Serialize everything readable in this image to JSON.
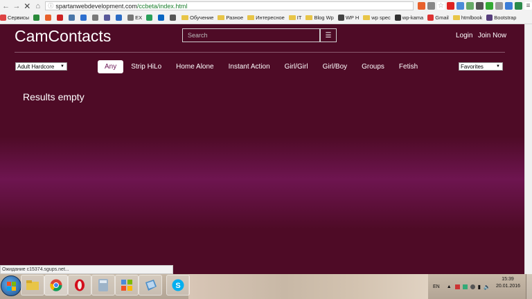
{
  "browser": {
    "url_host": "spartanwebdevelopment.com",
    "url_path": "/ccbeta/index.html",
    "bookmarks": [
      {
        "label": "Сервисы",
        "icon": "apps-grid-icon"
      },
      {
        "label": "",
        "icon": "green-shield-icon"
      },
      {
        "label": "",
        "icon": "orange-square-icon"
      },
      {
        "label": "",
        "icon": "red-square-icon"
      },
      {
        "label": "",
        "icon": "vk-icon"
      },
      {
        "label": "",
        "icon": "blue-square-icon"
      },
      {
        "label": "",
        "icon": "gray-square-icon"
      },
      {
        "label": "",
        "icon": "letter-square-icon"
      },
      {
        "label": "",
        "icon": "up-arrow-icon"
      },
      {
        "label": "EX",
        "icon": "ex-icon"
      },
      {
        "label": "",
        "icon": "green-circle-icon"
      },
      {
        "label": "",
        "icon": "linkedin-icon"
      },
      {
        "label": "",
        "icon": "play-icon"
      },
      {
        "label": "Обучение",
        "icon": "folder-icon"
      },
      {
        "label": "Разное",
        "icon": "folder-icon"
      },
      {
        "label": "Интересное",
        "icon": "folder-icon"
      },
      {
        "label": "IT",
        "icon": "folder-icon"
      },
      {
        "label": "Blog Wp",
        "icon": "folder-icon"
      },
      {
        "label": "WP H",
        "icon": "wordpress-icon"
      },
      {
        "label": "wp spec",
        "icon": "folder-icon"
      },
      {
        "label": "wp-kama",
        "icon": "kama-icon"
      },
      {
        "label": "Gmail",
        "icon": "gmail-icon"
      },
      {
        "label": "htmlbook",
        "icon": "folder-icon"
      },
      {
        "label": "Bootstrap",
        "icon": "bootstrap-icon"
      }
    ],
    "status_text": "Ожидание c15374.sgups.net..."
  },
  "site": {
    "brand": "CamContacts",
    "search_placeholder": "Search",
    "login": "Login",
    "join": "Join Now",
    "category_select": "Adult Hardcore",
    "favorites_select": "Favorites",
    "tabs": [
      "Any",
      "Strip HiLo",
      "Home Alone",
      "Instant Action",
      "Girl/Girl",
      "Girl/Boy",
      "Groups",
      "Fetish"
    ],
    "results_text": "Results empty"
  },
  "taskbar": {
    "lang": "EN",
    "time": "15:39",
    "date": "20.01.2016",
    "apps": [
      "file-explorer-icon",
      "chrome-icon",
      "opera-icon",
      "calculator-icon",
      "control-panel-icon",
      "virtualbox-icon",
      "skype-icon"
    ]
  },
  "colors": {
    "page_bg": "#4e0b26",
    "page_glow": "#6e1550",
    "active_tab_text": "#6a1553"
  }
}
